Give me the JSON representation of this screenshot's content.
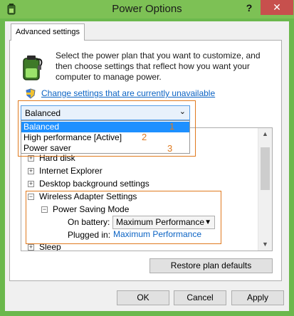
{
  "window": {
    "title": "Power Options",
    "help_label": "?",
    "close_label": "✕"
  },
  "tab": {
    "label": "Advanced settings"
  },
  "intro_text": "Select the power plan that you want to customize, and then choose settings that reflect how you want your computer to manage power.",
  "change_link": "Change settings that are currently unavailable",
  "plan_combo": {
    "value": "Balanced",
    "options": [
      {
        "label": "Balanced",
        "annotation": "1"
      },
      {
        "label": "High performance [Active]",
        "annotation": "2"
      },
      {
        "label": "Power saver",
        "annotation": "3"
      }
    ]
  },
  "tree": {
    "items": [
      {
        "label": "Hard disk",
        "expander": "+"
      },
      {
        "label": "Internet Explorer",
        "expander": "+"
      },
      {
        "label": "Desktop background settings",
        "expander": "+"
      },
      {
        "label": "Wireless Adapter Settings",
        "expander": "−"
      },
      {
        "label": "Power Saving Mode",
        "expander": "−"
      },
      {
        "label": "Sleep",
        "expander": "+"
      }
    ],
    "on_battery_label": "On battery:",
    "on_battery_value": "Maximum Performance",
    "plugged_in_label": "Plugged in:",
    "plugged_in_value": "Maximum Performance"
  },
  "buttons": {
    "restore": "Restore plan defaults",
    "ok": "OK",
    "cancel": "Cancel",
    "apply": "Apply"
  },
  "colors": {
    "titlebar": "#7dc155",
    "close": "#c7504d",
    "highlight": "#e07a1f",
    "link": "#0b63c4",
    "selection": "#1e90ff"
  }
}
